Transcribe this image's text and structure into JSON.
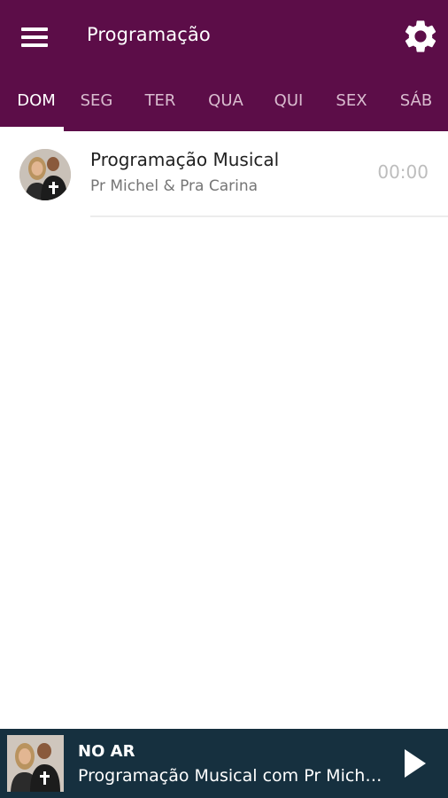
{
  "header": {
    "title": "Programação",
    "menu_icon": "hamburger-menu-icon",
    "settings_icon": "gear-icon",
    "background": "#5c0d48"
  },
  "tabs": [
    {
      "label": "DOM",
      "active": true
    },
    {
      "label": "SEG",
      "active": false
    },
    {
      "label": "TER",
      "active": false
    },
    {
      "label": "QUA",
      "active": false
    },
    {
      "label": "QUI",
      "active": false
    },
    {
      "label": "SEX",
      "active": false
    },
    {
      "label": "SÁB",
      "active": false
    }
  ],
  "schedule": [
    {
      "title": "Programação Musical",
      "hosts": "Pr Michel & Pra Carina",
      "time": "00:00"
    }
  ],
  "player": {
    "label": "NO AR",
    "now_playing": "Programação Musical com Pr Michel & Pra Carina",
    "play_icon": "play-icon",
    "background": "#16303f"
  }
}
